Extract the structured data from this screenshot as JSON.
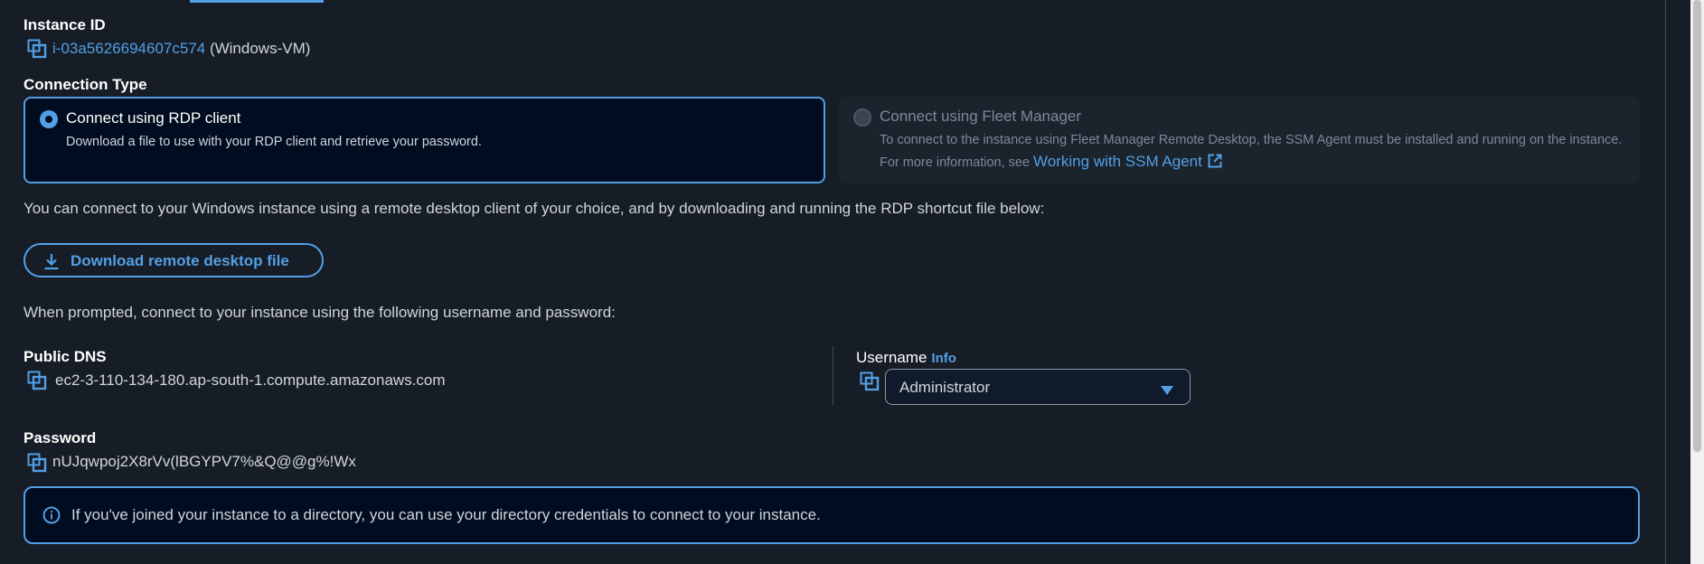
{
  "instance": {
    "label": "Instance ID",
    "id": "i-03a5626694607c574",
    "name_suffix": "(Windows-VM)"
  },
  "connection_type": {
    "label": "Connection Type",
    "rdp": {
      "title": "Connect using RDP client",
      "description": "Download a file to use with your RDP client and retrieve your password.",
      "selected": true
    },
    "fleet": {
      "title": "Connect using Fleet Manager",
      "description": "To connect to the instance using Fleet Manager Remote Desktop, the SSM Agent must be installed and running on the instance. For more information, see",
      "link": "Working with SSM Agent",
      "disabled": true
    }
  },
  "intro_text": "You can connect to your Windows instance using a remote desktop client of your choice, and by downloading and running the RDP shortcut file below:",
  "download_button": "Download remote desktop file",
  "prompt_text": "When prompted, connect to your instance using the following username and password:",
  "public_dns": {
    "label": "Public DNS",
    "value": "ec2-3-110-134-180.ap-south-1.compute.amazonaws.com"
  },
  "username": {
    "label": "Username",
    "info_link": "Info",
    "selected": "Administrator"
  },
  "password": {
    "label": "Password",
    "value": "nUJqwpoj2X8rVv(lBGYPV7%&Q@@g%!Wx"
  },
  "alert": {
    "text": "If you've joined your instance to a directory, you can use your directory credentials to connect to your instance."
  },
  "colors": {
    "accent": "#539fe5",
    "background": "#161d26",
    "selected_tile": "#000c1f"
  },
  "icons": {
    "copy": "copy-icon",
    "download": "download-icon",
    "external": "external-link-icon",
    "caret": "caret-down-icon",
    "info": "info-circle-icon"
  }
}
